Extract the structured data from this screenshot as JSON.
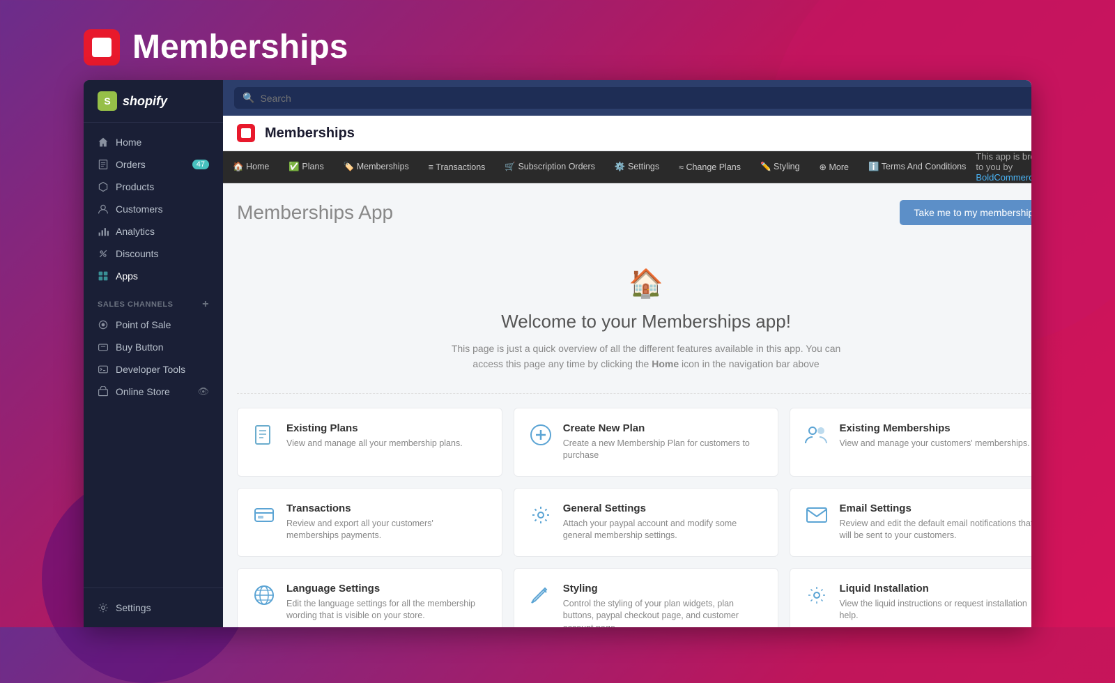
{
  "appHeader": {
    "title": "Memberships",
    "logoAlt": "Bold app logo"
  },
  "shopify": {
    "logoText": "shopify"
  },
  "topBar": {
    "searchPlaceholder": "Search"
  },
  "sidebar": {
    "items": [
      {
        "id": "home",
        "label": "Home",
        "icon": "home"
      },
      {
        "id": "orders",
        "label": "Orders",
        "icon": "orders",
        "badge": "47"
      },
      {
        "id": "products",
        "label": "Products",
        "icon": "products"
      },
      {
        "id": "customers",
        "label": "Customers",
        "icon": "customers"
      },
      {
        "id": "analytics",
        "label": "Analytics",
        "icon": "analytics"
      },
      {
        "id": "discounts",
        "label": "Discounts",
        "icon": "discounts"
      },
      {
        "id": "apps",
        "label": "Apps",
        "icon": "apps",
        "active": true
      }
    ],
    "salesChannels": {
      "label": "SALES CHANNELS",
      "items": [
        {
          "id": "point-of-sale",
          "label": "Point of Sale",
          "icon": "pos"
        },
        {
          "id": "buy-button",
          "label": "Buy Button",
          "icon": "buy"
        },
        {
          "id": "developer-tools",
          "label": "Developer Tools",
          "icon": "dev"
        },
        {
          "id": "online-store",
          "label": "Online Store",
          "icon": "store"
        }
      ]
    },
    "bottom": {
      "settings": "Settings"
    }
  },
  "darkNav": {
    "items": [
      {
        "id": "home",
        "label": "🏠 Home"
      },
      {
        "id": "plans",
        "label": "✅ Plans"
      },
      {
        "id": "memberships",
        "label": "🏷️ Memberships"
      },
      {
        "id": "transactions",
        "label": "≡ Transactions"
      },
      {
        "id": "subscription-orders",
        "label": "🛒 Subscription Orders"
      },
      {
        "id": "settings",
        "label": "⚙️ Settings"
      },
      {
        "id": "change-plans",
        "label": "≈ Change Plans"
      },
      {
        "id": "styling",
        "label": "✏️ Styling"
      },
      {
        "id": "more",
        "label": "⊕ More"
      },
      {
        "id": "terms",
        "label": "ℹ️ Terms And Conditions"
      }
    ],
    "broughtBy": "This app is brought to you by ",
    "broughtByLink": "BoldCommerce.com"
  },
  "appContent": {
    "appBarTitle": "Memberships",
    "sectionTitle": "Memberships App",
    "takeMeBtn": "Take me to my memberships!",
    "welcomeTitle": "Welcome to your Memberships app!",
    "welcomeDesc": "This page is just a quick overview of all the different features available in this app. You can access this page any time by clicking the Home icon in the navigation bar above",
    "cards": [
      {
        "id": "existing-plans",
        "icon": "doc",
        "title": "Existing Plans",
        "desc": "View and manage all your membership plans."
      },
      {
        "id": "create-new-plan",
        "icon": "plus",
        "title": "Create New Plan",
        "desc": "Create a new Membership Plan for customers to purchase"
      },
      {
        "id": "existing-memberships",
        "icon": "people",
        "title": "Existing Memberships",
        "desc": "View and manage your customers' memberships."
      },
      {
        "id": "transactions",
        "icon": "card",
        "title": "Transactions",
        "desc": "Review and export all your customers' memberships payments."
      },
      {
        "id": "general-settings",
        "icon": "gear",
        "title": "General Settings",
        "desc": "Attach your paypal account and modify some general membership settings."
      },
      {
        "id": "email-settings",
        "icon": "email",
        "title": "Email Settings",
        "desc": "Review and edit the default email notifications that will be sent to your customers."
      },
      {
        "id": "language-settings",
        "icon": "lang",
        "title": "Language Settings",
        "desc": "Edit the language settings for all the membership wording that is visible on your store."
      },
      {
        "id": "styling",
        "icon": "brush",
        "title": "Styling",
        "desc": "Control the styling of your plan widgets, plan buttons, paypal checkout page, and customer account page."
      },
      {
        "id": "liquid-installation",
        "icon": "liquid",
        "title": "Liquid Installation",
        "desc": "View the liquid instructions or request installation help."
      }
    ]
  }
}
